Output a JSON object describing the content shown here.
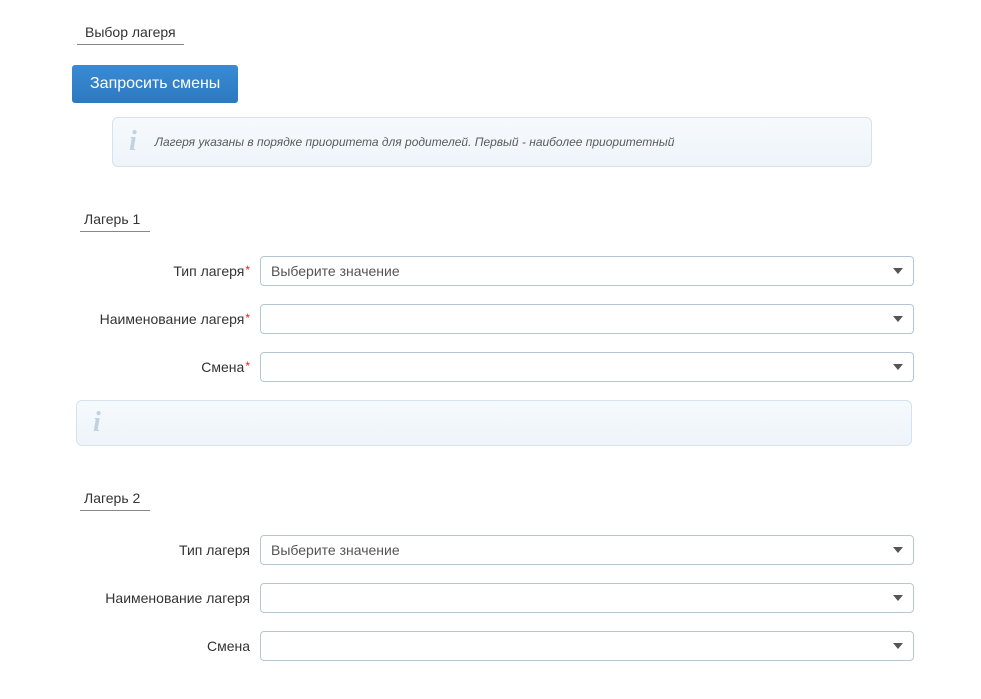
{
  "tab_title": "Выбор лагеря",
  "button_request": "Запросить смены",
  "info_priority": "Лагеря указаны в порядке приоритета для родителей. Первый - наиболее приоритетный",
  "camps": [
    {
      "header": "Лагерь 1",
      "required": true,
      "type_label": "Тип лагеря",
      "type_placeholder": "Выберите значение",
      "name_label": "Наименование лагеря",
      "name_placeholder": "",
      "shift_label": "Смена",
      "shift_placeholder": ""
    },
    {
      "header": "Лагерь 2",
      "required": false,
      "type_label": "Тип лагеря",
      "type_placeholder": "Выберите значение",
      "name_label": "Наименование лагеря",
      "name_placeholder": "",
      "shift_label": "Смена",
      "shift_placeholder": ""
    }
  ]
}
